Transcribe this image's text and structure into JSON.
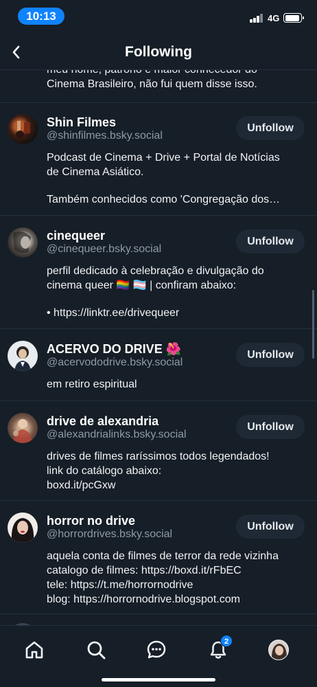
{
  "status_bar": {
    "time": "10:13",
    "network": "4G"
  },
  "header": {
    "title": "Following",
    "back_icon": "chevron-left-icon"
  },
  "partial_bio": "meu nome, patrono e maior conhecedor do\nCinema Brasileiro, não fui quem disse isso.",
  "accounts": [
    {
      "name": "Shin Filmes",
      "handle": "@shinfilmes.bsky.social",
      "button": "Unfollow",
      "bio": "Podcast de Cinema + Drive + Portal de Notícias\nde Cinema Asiático.",
      "bio_extra": "Também conhecidos como 'Congregação dos…"
    },
    {
      "name": "cinequeer",
      "handle": "@cinequeer.bsky.social",
      "button": "Unfollow",
      "bio": "perfil dedicado à celebração e divulgação do\ncinema queer 🏳️‍🌈 🏳️‍⚧️ | confiram abaixo:",
      "bio_extra": "• https://linktr.ee/drivequeer"
    },
    {
      "name": "ACERVO DO DRIVE 🌺",
      "handle": "@acervododrive.bsky.social",
      "button": "Unfollow",
      "bio": "em retiro espiritual"
    },
    {
      "name": "drive de alexandria",
      "handle": "@alexandrialinks.bsky.social",
      "button": "Unfollow",
      "bio": "drives de filmes raríssimos todos legendados!\nlink do catálogo abaixo:\nboxd.it/pcGxw"
    },
    {
      "name": "horror no drive",
      "handle": "@horrordrives.bsky.social",
      "button": "Unfollow",
      "bio": "aquela conta de filmes de terror da rede vizinha\ncatalogo de filmes: https://boxd.it/rFbEC\ntele: https://t.me/horrornodrive\nblog: https://horrornodrive.blogspot.com"
    }
  ],
  "tab_bar": {
    "tabs": [
      "home-icon",
      "search-icon",
      "chat-icon",
      "bell-icon",
      "profile-avatar"
    ],
    "notification_badge": "2"
  },
  "colors": {
    "background": "#161e27",
    "accent": "#1083fe",
    "button_bg": "#1f2935",
    "muted_text": "#8e9aa7"
  }
}
